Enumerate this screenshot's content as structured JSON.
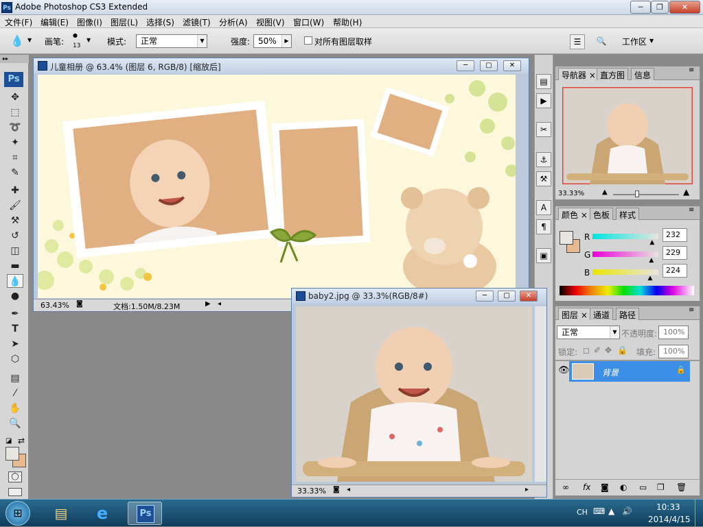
{
  "window": {
    "title": "Adobe Photoshop CS3 Extended",
    "app_icon_text": "Ps"
  },
  "menubar": {
    "items": [
      "文件(F)",
      "编辑(E)",
      "图像(I)",
      "图层(L)",
      "选择(S)",
      "滤镜(T)",
      "分析(A)",
      "视图(V)",
      "窗口(W)",
      "帮助(H)"
    ]
  },
  "options": {
    "brush_label": "画笔:",
    "brush_size": "13",
    "mode_label": "模式:",
    "mode_value": "正常",
    "strength_label": "强度:",
    "strength_value": "50%",
    "sample_all_label": "对所有图层取样",
    "workspace_label": "工作区"
  },
  "doc1": {
    "title": "儿童相册 @ 63.4% (图层 6, RGB/8) [缩放后]",
    "zoom": "63.43%",
    "doc_info": "文档:1.50M/8.23M"
  },
  "doc2": {
    "title": "baby2.jpg @ 33.3%(RGB/8#)",
    "zoom": "33.33%"
  },
  "navigator": {
    "tabs": [
      "导航器",
      "直方图",
      "信息"
    ],
    "zoom": "33.33%"
  },
  "color": {
    "tabs": [
      "颜色",
      "色板",
      "样式"
    ],
    "channels": [
      {
        "label": "R",
        "value": "232",
        "position": 0.91
      },
      {
        "label": "G",
        "value": "229",
        "position": 0.9
      },
      {
        "label": "B",
        "value": "224",
        "position": 0.88
      }
    ]
  },
  "layers": {
    "tabs": [
      "图层",
      "通道",
      "路径"
    ],
    "blend_mode": "正常",
    "opacity_label": "不透明度:",
    "opacity_value": "100%",
    "lock_label": "锁定:",
    "fill_label": "填充:",
    "fill_value": "100%",
    "layer_name": "背景"
  },
  "taskbar": {
    "lang": "CH",
    "time": "10:33",
    "date": "2014/4/15",
    "ps_label": "Ps"
  }
}
